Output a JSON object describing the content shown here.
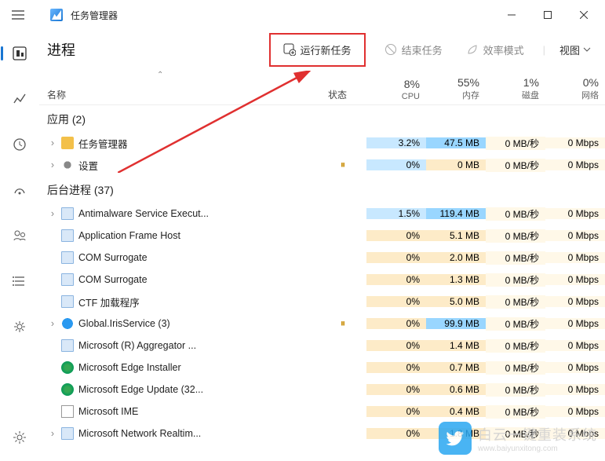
{
  "title": "任务管理器",
  "page": "进程",
  "actions": {
    "run": "运行新任务",
    "end": "结束任务",
    "eff": "效率模式",
    "view": "视图"
  },
  "headers": {
    "name": "名称",
    "status": "状态",
    "cols": [
      {
        "pct": "8%",
        "lbl": "CPU"
      },
      {
        "pct": "55%",
        "lbl": "内存"
      },
      {
        "pct": "1%",
        "lbl": "磁盘"
      },
      {
        "pct": "0%",
        "lbl": "网络"
      }
    ]
  },
  "groups": {
    "apps": "应用 (2)",
    "bg": "后台进程 (37)"
  },
  "rows": [
    {
      "exp": true,
      "ico": "app",
      "nm": "任务管理器",
      "st": "",
      "c": [
        "3.2%",
        "47.5 MB",
        "0 MB/秒",
        "0 Mbps"
      ],
      "hl": [
        "cpu",
        "mem",
        "h0",
        "h0"
      ]
    },
    {
      "exp": true,
      "ico": "gear",
      "nm": "设置",
      "st": "⏸",
      "c": [
        "0%",
        "0 MB",
        "0 MB/秒",
        "0 Mbps"
      ],
      "hl": [
        "cpu",
        "h1",
        "h0",
        "h0"
      ]
    },
    {
      "group": "bg"
    },
    {
      "exp": true,
      "ico": "proc",
      "nm": "Antimalware Service Execut...",
      "st": "",
      "c": [
        "1.5%",
        "119.4 MB",
        "0 MB/秒",
        "0 Mbps"
      ],
      "hl": [
        "cpu",
        "mem",
        "h0",
        "h0"
      ]
    },
    {
      "exp": false,
      "ico": "proc",
      "nm": "Application Frame Host",
      "st": "",
      "c": [
        "0%",
        "5.1 MB",
        "0 MB/秒",
        "0 Mbps"
      ],
      "hl": [
        "h1",
        "h1",
        "h0",
        "h0"
      ]
    },
    {
      "exp": false,
      "ico": "proc",
      "nm": "COM Surrogate",
      "st": "",
      "c": [
        "0%",
        "2.0 MB",
        "0 MB/秒",
        "0 Mbps"
      ],
      "hl": [
        "h1",
        "h1",
        "h0",
        "h0"
      ]
    },
    {
      "exp": false,
      "ico": "proc",
      "nm": "COM Surrogate",
      "st": "",
      "c": [
        "0%",
        "1.3 MB",
        "0 MB/秒",
        "0 Mbps"
      ],
      "hl": [
        "h1",
        "h1",
        "h0",
        "h0"
      ]
    },
    {
      "exp": false,
      "ico": "proc",
      "nm": "CTF 加载程序",
      "st": "",
      "c": [
        "0%",
        "5.0 MB",
        "0 MB/秒",
        "0 Mbps"
      ],
      "hl": [
        "h1",
        "h1",
        "h0",
        "h0"
      ]
    },
    {
      "exp": true,
      "ico": "globe",
      "nm": "Global.IrisService (3)",
      "st": "⏸",
      "c": [
        "0%",
        "99.9 MB",
        "0 MB/秒",
        "0 Mbps"
      ],
      "hl": [
        "h1",
        "mem",
        "h0",
        "h0"
      ]
    },
    {
      "exp": false,
      "ico": "proc",
      "nm": "Microsoft (R) Aggregator ...",
      "st": "",
      "c": [
        "0%",
        "1.4 MB",
        "0 MB/秒",
        "0 Mbps"
      ],
      "hl": [
        "h1",
        "h1",
        "h0",
        "h0"
      ]
    },
    {
      "exp": false,
      "ico": "edge",
      "nm": "Microsoft Edge Installer",
      "st": "",
      "c": [
        "0%",
        "0.7 MB",
        "0 MB/秒",
        "0 Mbps"
      ],
      "hl": [
        "h1",
        "h1",
        "h0",
        "h0"
      ]
    },
    {
      "exp": false,
      "ico": "edge",
      "nm": "Microsoft Edge Update (32...",
      "st": "",
      "c": [
        "0%",
        "0.6 MB",
        "0 MB/秒",
        "0 Mbps"
      ],
      "hl": [
        "h1",
        "h1",
        "h0",
        "h0"
      ]
    },
    {
      "exp": false,
      "ico": "ime",
      "nm": "Microsoft IME",
      "st": "",
      "c": [
        "0%",
        "0.4 MB",
        "0 MB/秒",
        "0 Mbps"
      ],
      "hl": [
        "h1",
        "h1",
        "h0",
        "h0"
      ]
    },
    {
      "exp": true,
      "ico": "proc",
      "nm": "Microsoft Network Realtim...",
      "st": "",
      "c": [
        "0%",
        "1.8 MB",
        "0 MB/秒",
        "0 Mbps"
      ],
      "hl": [
        "h1",
        "h1",
        "h0",
        "h0"
      ]
    }
  ],
  "watermark": {
    "txt": "白云一键重装系统",
    "url": "www.baiyunxitong.com"
  }
}
